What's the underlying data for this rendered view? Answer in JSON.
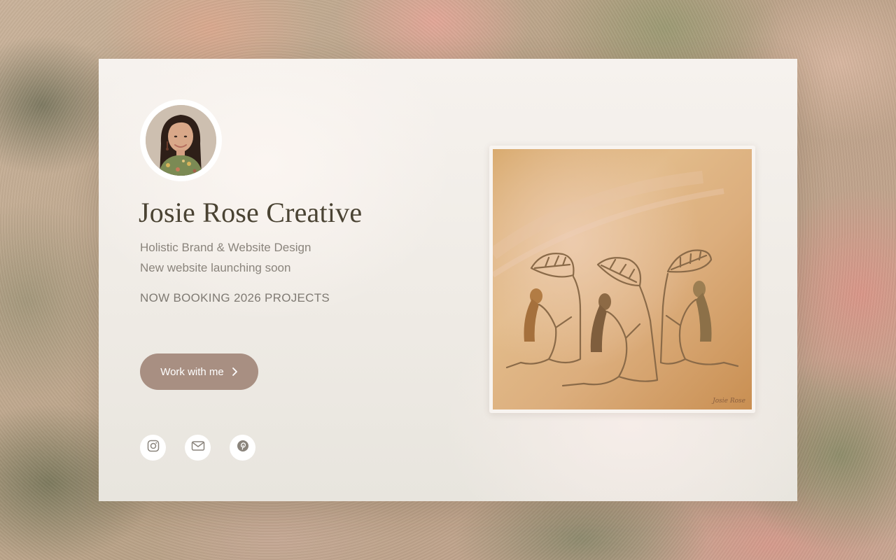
{
  "profile": {
    "name": "Josie Rose Creative",
    "tagline_1": "Holistic Brand & Website Design",
    "tagline_2": "New website launching soon",
    "booking_notice": "NOW BOOKING 2026 PROJECTS",
    "avatar_alt": "Portrait of Josie Rose"
  },
  "cta": {
    "label": "Work with me",
    "icon": "chevron-right-icon"
  },
  "social": [
    {
      "name": "Instagram",
      "icon": "instagram-icon"
    },
    {
      "name": "Email",
      "icon": "mail-icon"
    },
    {
      "name": "Pinterest",
      "icon": "pinterest-icon"
    }
  ],
  "artwork": {
    "signature": "Josie Rose",
    "description_icon": "three-women-holding-leaves-illustration"
  },
  "colors": {
    "title": "#4a4333",
    "text": "#8a847c",
    "button": "#a88f82",
    "card": "#f3efea",
    "line_art": "#8a6a48"
  }
}
